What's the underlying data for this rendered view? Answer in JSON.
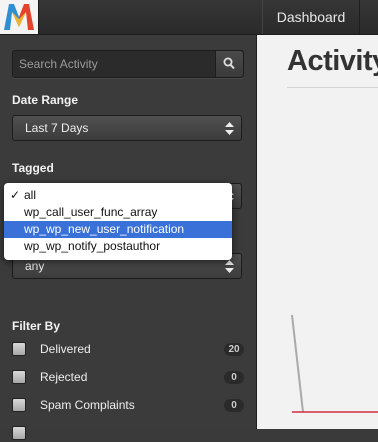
{
  "topbar": {
    "nav_dashboard": "Dashboard"
  },
  "search": {
    "placeholder": "Search Activity"
  },
  "date_range": {
    "label": "Date Range",
    "selected": "Last 7 Days"
  },
  "tagged": {
    "label": "Tagged",
    "options": [
      "all",
      "wp_call_user_func_array",
      "wp_wp_new_user_notification",
      "wp_wp_notify_postauthor"
    ],
    "checked": "all",
    "highlighted": "wp_wp_new_user_notification"
  },
  "second_select": {
    "selected": "any"
  },
  "filter_by": {
    "label": "Filter By",
    "items": [
      {
        "label": "Delivered",
        "count": "20"
      },
      {
        "label": "Rejected",
        "count": "0"
      },
      {
        "label": "Spam Complaints",
        "count": "0"
      }
    ]
  },
  "main": {
    "title": "Activity"
  },
  "colors": {
    "accent_highlight": "#3a71d8",
    "chart_line": "#aaaaaa",
    "chart_baseline": "#d03040"
  }
}
